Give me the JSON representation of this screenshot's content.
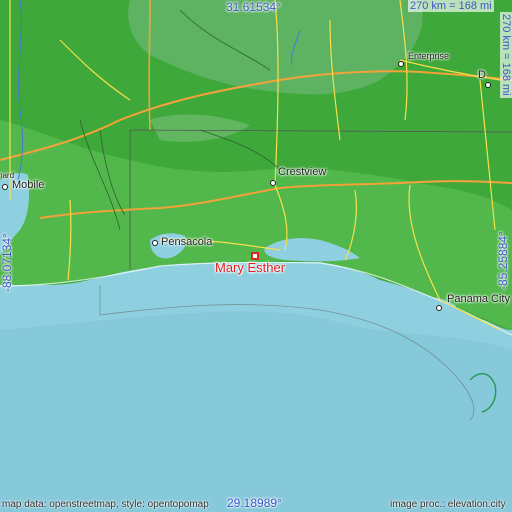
{
  "map": {
    "colors": {
      "water": "#8fd0e0",
      "land_low": "#4fb648",
      "land_mid": "#3fa43c",
      "land_high": "#5fb06a",
      "road_major": "#f2a23a",
      "road_minor": "#f5e04a",
      "state_border": "#555555"
    },
    "target": {
      "name": "Mary Esther"
    },
    "cities": [
      {
        "id": "mobile",
        "name": "Mobile"
      },
      {
        "id": "pensacola",
        "name": "Pensacola"
      },
      {
        "id": "crestview",
        "name": "Crestview"
      },
      {
        "id": "enterprise",
        "name": "Enterprise"
      },
      {
        "id": "panama-city",
        "name": "Panama City"
      },
      {
        "id": "d-city",
        "name": "D"
      },
      {
        "id": "hard",
        "name": "hard"
      }
    ],
    "coordinates": {
      "north": "31.61534°",
      "south": "29.18989°",
      "west": "-88.07134°",
      "east": "-85.25884°"
    },
    "scale": {
      "horizontal": "270 km = 168 mi",
      "vertical": "270 km = 168 mi"
    },
    "credits": {
      "left": "map data: openstreetmap, style: opentopomap",
      "right": "image proc.: elevation.city"
    }
  }
}
